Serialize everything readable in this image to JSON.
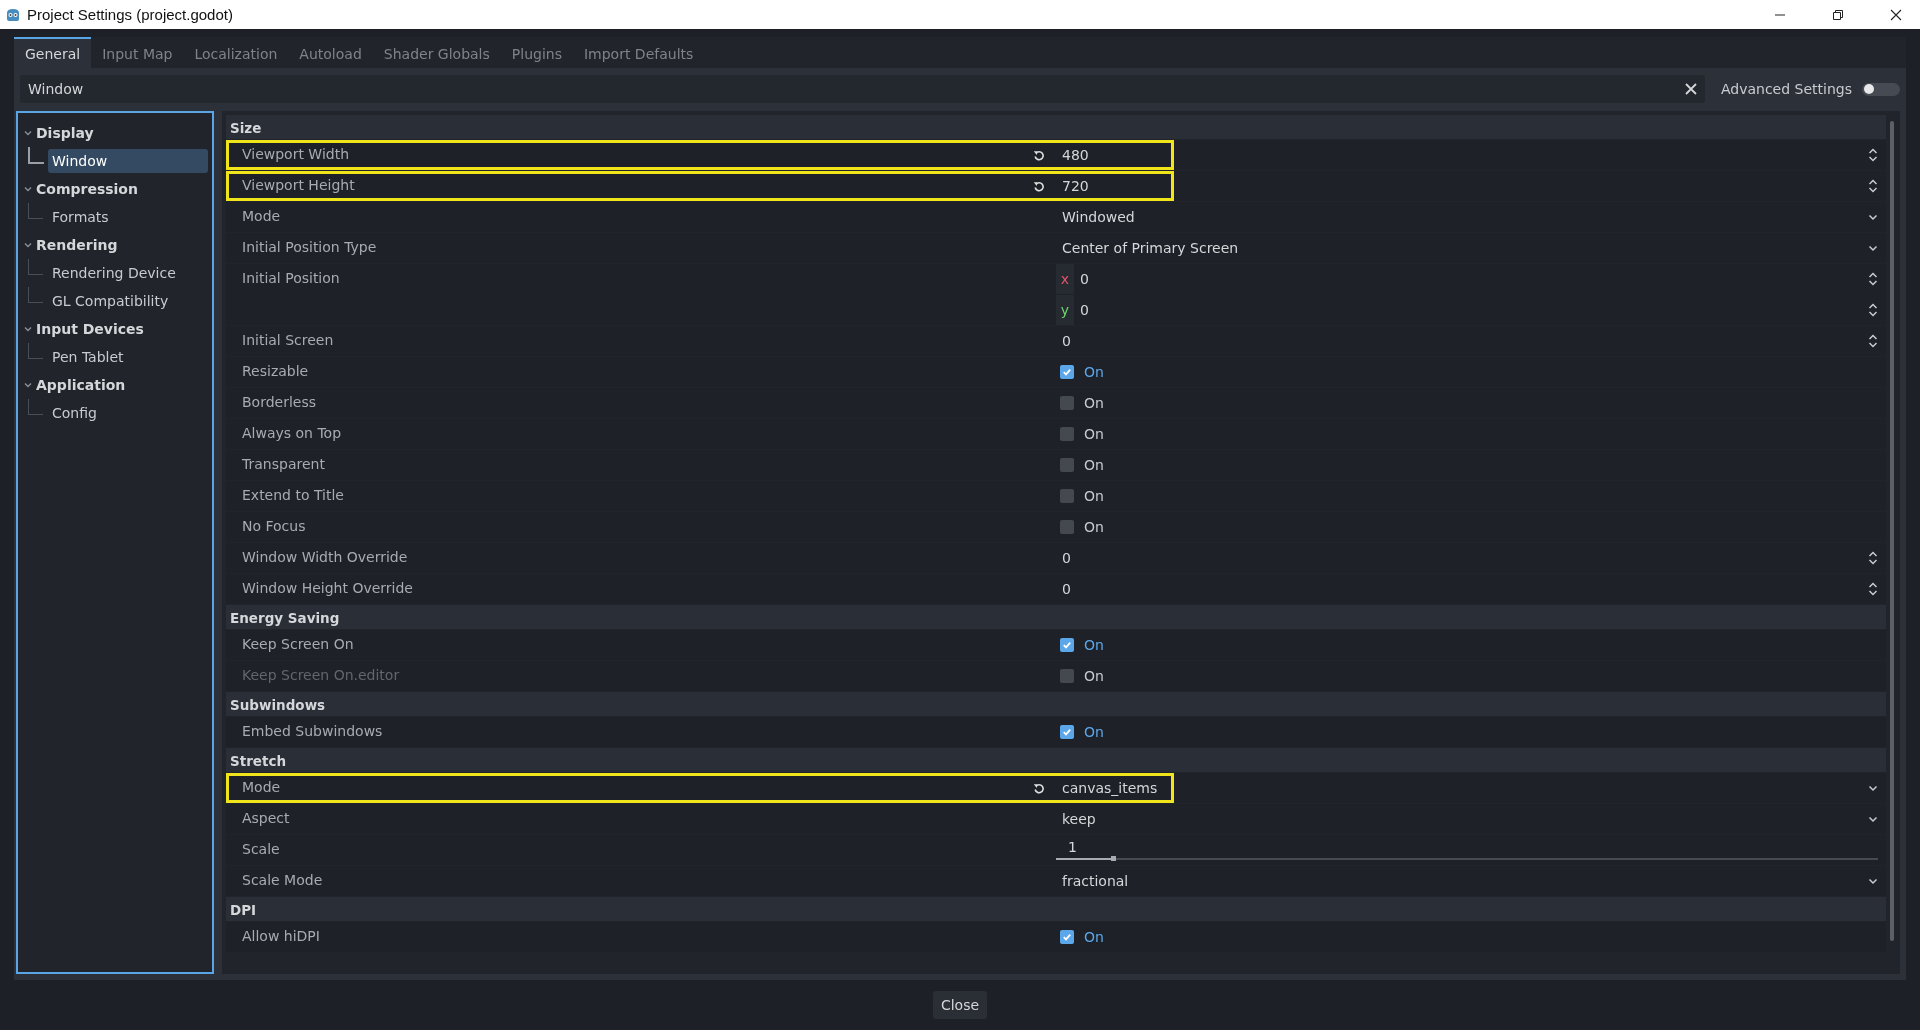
{
  "window": {
    "title": "Project Settings (project.godot)"
  },
  "tabs": [
    {
      "label": "General",
      "selected": true
    },
    {
      "label": "Input Map",
      "selected": false
    },
    {
      "label": "Localization",
      "selected": false
    },
    {
      "label": "Autoload",
      "selected": false
    },
    {
      "label": "Shader Globals",
      "selected": false
    },
    {
      "label": "Plugins",
      "selected": false
    },
    {
      "label": "Import Defaults",
      "selected": false
    }
  ],
  "filter": {
    "value": "Window"
  },
  "advanced_settings": {
    "label": "Advanced Settings",
    "on": false
  },
  "sidebar": {
    "items": [
      {
        "label": "Display",
        "expanded": true,
        "children": [
          {
            "label": "Window",
            "selected": true
          }
        ]
      },
      {
        "label": "Compression",
        "expanded": true,
        "children": [
          {
            "label": "Formats",
            "selected": false
          }
        ]
      },
      {
        "label": "Rendering",
        "expanded": true,
        "children": [
          {
            "label": "Rendering Device",
            "selected": false
          },
          {
            "label": "GL Compatibility",
            "selected": false
          }
        ]
      },
      {
        "label": "Input Devices",
        "expanded": true,
        "children": [
          {
            "label": "Pen Tablet",
            "selected": false
          }
        ]
      },
      {
        "label": "Application",
        "expanded": true,
        "children": [
          {
            "label": "Config",
            "selected": false
          }
        ]
      }
    ]
  },
  "sections": [
    {
      "title": "Size",
      "rows": [
        {
          "kind": "number",
          "label": "Viewport Width",
          "value": "480",
          "revert": true,
          "highlighted": true,
          "disabled": false
        },
        {
          "kind": "number",
          "label": "Viewport Height",
          "value": "720",
          "revert": true,
          "highlighted": true,
          "disabled": false
        },
        {
          "kind": "enum",
          "label": "Mode",
          "value": "Windowed",
          "revert": false,
          "highlighted": false,
          "disabled": false
        },
        {
          "kind": "enum",
          "label": "Initial Position Type",
          "value": "Center of Primary Screen",
          "revert": false,
          "highlighted": false,
          "disabled": false
        },
        {
          "kind": "vector",
          "label": "Initial Position",
          "components": [
            {
              "axis": "x",
              "value": "0"
            },
            {
              "axis": "y",
              "value": "0"
            }
          ],
          "revert": false,
          "highlighted": false,
          "disabled": false
        },
        {
          "kind": "number",
          "label": "Initial Screen",
          "value": "0",
          "revert": false,
          "highlighted": false,
          "disabled": false
        },
        {
          "kind": "check",
          "label": "Resizable",
          "value": "On",
          "checked": true,
          "revert": false,
          "highlighted": false,
          "disabled": false
        },
        {
          "kind": "check",
          "label": "Borderless",
          "value": "On",
          "checked": false,
          "revert": false,
          "highlighted": false,
          "disabled": false
        },
        {
          "kind": "check",
          "label": "Always on Top",
          "value": "On",
          "checked": false,
          "revert": false,
          "highlighted": false,
          "disabled": false
        },
        {
          "kind": "check",
          "label": "Transparent",
          "value": "On",
          "checked": false,
          "revert": false,
          "highlighted": false,
          "disabled": false
        },
        {
          "kind": "check",
          "label": "Extend to Title",
          "value": "On",
          "checked": false,
          "revert": false,
          "highlighted": false,
          "disabled": false
        },
        {
          "kind": "check",
          "label": "No Focus",
          "value": "On",
          "checked": false,
          "revert": false,
          "highlighted": false,
          "disabled": false
        },
        {
          "kind": "number",
          "label": "Window Width Override",
          "value": "0",
          "revert": false,
          "highlighted": false,
          "disabled": false
        },
        {
          "kind": "number",
          "label": "Window Height Override",
          "value": "0",
          "revert": false,
          "highlighted": false,
          "disabled": false
        }
      ]
    },
    {
      "title": "Energy Saving",
      "rows": [
        {
          "kind": "check",
          "label": "Keep Screen On",
          "value": "On",
          "checked": true,
          "revert": false,
          "highlighted": false,
          "disabled": false
        },
        {
          "kind": "check",
          "label": "Keep Screen On.editor",
          "value": "On",
          "checked": false,
          "revert": false,
          "highlighted": false,
          "disabled": true
        }
      ]
    },
    {
      "title": "Subwindows",
      "rows": [
        {
          "kind": "check",
          "label": "Embed Subwindows",
          "value": "On",
          "checked": true,
          "revert": false,
          "highlighted": false,
          "disabled": false
        }
      ]
    },
    {
      "title": "Stretch",
      "rows": [
        {
          "kind": "enum",
          "label": "Mode",
          "value": "canvas_items",
          "revert": true,
          "highlighted": true,
          "disabled": false
        },
        {
          "kind": "enum",
          "label": "Aspect",
          "value": "keep",
          "revert": false,
          "highlighted": false,
          "disabled": false
        },
        {
          "kind": "slider",
          "label": "Scale",
          "value": "1",
          "level": 0.07,
          "revert": false,
          "highlighted": false,
          "disabled": false
        },
        {
          "kind": "enum",
          "label": "Scale Mode",
          "value": "fractional",
          "revert": false,
          "highlighted": false,
          "disabled": false
        }
      ]
    },
    {
      "title": "DPI",
      "rows": [
        {
          "kind": "check",
          "label": "Allow hiDPI",
          "value": "On",
          "checked": true,
          "revert": false,
          "highlighted": false,
          "disabled": false
        }
      ]
    }
  ],
  "close_button": "Close"
}
